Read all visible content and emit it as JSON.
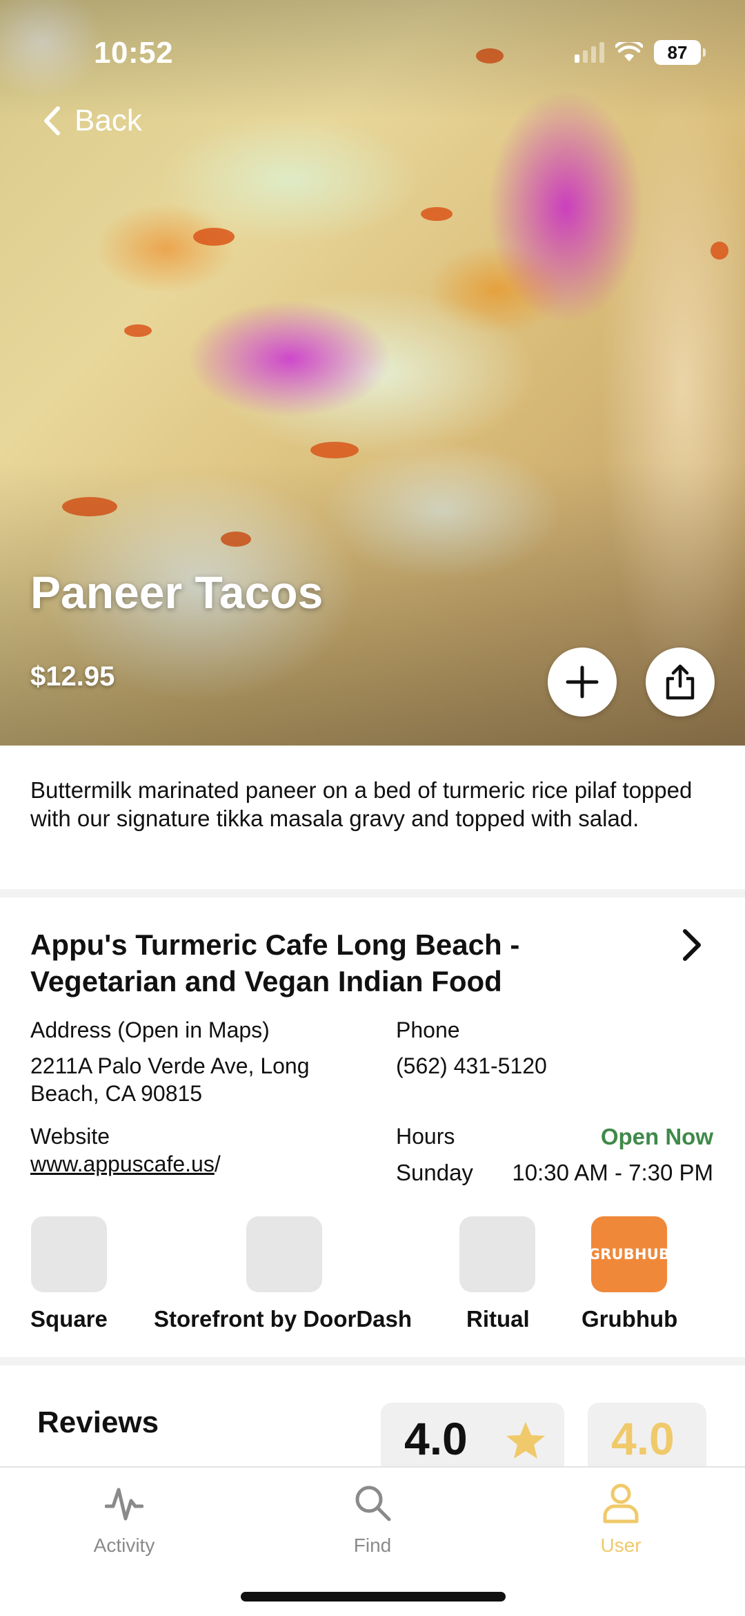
{
  "status_bar": {
    "time": "10:52",
    "battery": "87"
  },
  "nav": {
    "back_label": "Back",
    "back_icon": "chevron-left-icon"
  },
  "item": {
    "name": "Paneer Tacos",
    "price": "$12.95",
    "description": "Buttermilk marinated paneer on a bed of turmeric rice pilaf topped with our signature tikka masala gravy and topped with salad.",
    "add_icon": "plus-icon",
    "share_icon": "share-icon"
  },
  "restaurant": {
    "name": "Appu's Turmeric Cafe Long Beach - Vegetarian and Vegan Indian Food",
    "address_label": "Address (Open in Maps)",
    "address_line1": "2211A Palo Verde Ave, Long",
    "address_line2": "Beach, CA 90815",
    "phone_label": "Phone",
    "phone": "(562) 431-5120",
    "website_label": "Website",
    "website_linked": "www.appuscafe.us",
    "website_tail": "/",
    "hours_label": "Hours",
    "open_status": "Open Now",
    "open_status_color": "#3f8a4a",
    "hours_day": "Sunday",
    "hours_time": "10:30 AM - 7:30 PM"
  },
  "ordering": [
    {
      "label": "Square"
    },
    {
      "label": "Storefront by DoorDash"
    },
    {
      "label": "Ritual"
    },
    {
      "label": "Grubhub",
      "logo_text": "GRUBHUB",
      "color": "#f0883a"
    }
  ],
  "reviews": {
    "title": "Reviews",
    "rating": "4.0",
    "rating_secondary": "4.0",
    "star_color": "#f0c96a"
  },
  "tabs": [
    {
      "label": "Activity",
      "icon": "activity-icon"
    },
    {
      "label": "Find",
      "icon": "search-icon"
    },
    {
      "label": "User",
      "icon": "user-icon",
      "active": true,
      "active_color": "#f0c96a"
    }
  ]
}
